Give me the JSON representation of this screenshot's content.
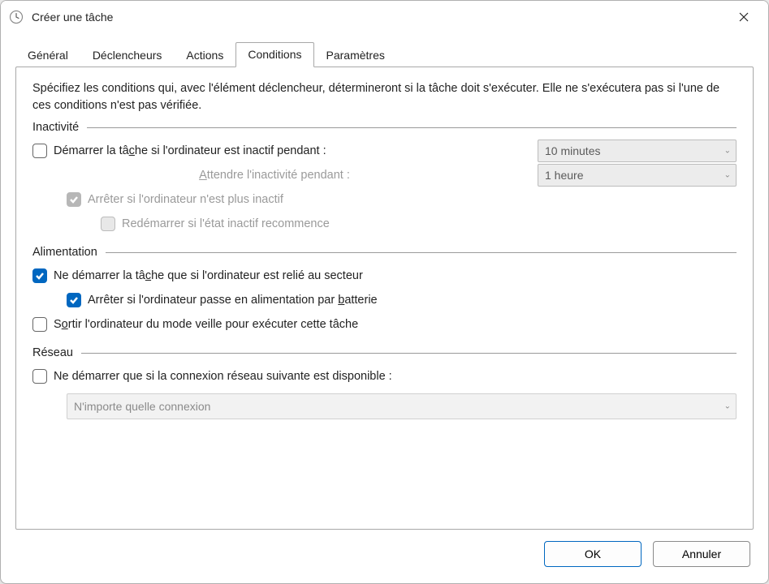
{
  "window": {
    "title": "Créer une tâche"
  },
  "tabs": {
    "general": "Général",
    "triggers": "Déclencheurs",
    "actions": "Actions",
    "conditions": "Conditions",
    "settings": "Paramètres",
    "active": "conditions"
  },
  "intro": "Spécifiez les conditions qui, avec l'élément déclencheur, détermineront si la tâche doit s'exécuter. Elle ne s'exécutera pas si l'une de ces conditions n'est pas vérifiée.",
  "sections": {
    "idle": {
      "title": "Inactivité",
      "start_if_idle": "Démarrer la tâche si l'ordinateur est inactif pendant :",
      "idle_duration": "10 minutes",
      "wait_label": "Attendre l'inactivité pendant :",
      "wait_duration": "1 heure",
      "stop_if_not_idle": "Arrêter si l'ordinateur n'est plus inactif",
      "restart_if_idle": "Redémarrer si l'état inactif recommence"
    },
    "power": {
      "title": "Alimentation",
      "only_on_ac": "Ne démarrer la tâche que si l'ordinateur est relié au secteur",
      "stop_on_battery": "Arrêter si l'ordinateur passe en alimentation par batterie",
      "wake_to_run": "Sortir l'ordinateur du mode veille pour exécuter cette tâche"
    },
    "network": {
      "title": "Réseau",
      "only_if_network": "Ne démarrer que si la connexion réseau suivante est disponible :",
      "connection": "N'importe quelle connexion"
    }
  },
  "buttons": {
    "ok": "OK",
    "cancel": "Annuler"
  },
  "state": {
    "start_if_idle": false,
    "stop_if_not_idle": true,
    "restart_if_idle": false,
    "only_on_ac": true,
    "stop_on_battery": true,
    "wake_to_run": false,
    "only_if_network": false
  }
}
